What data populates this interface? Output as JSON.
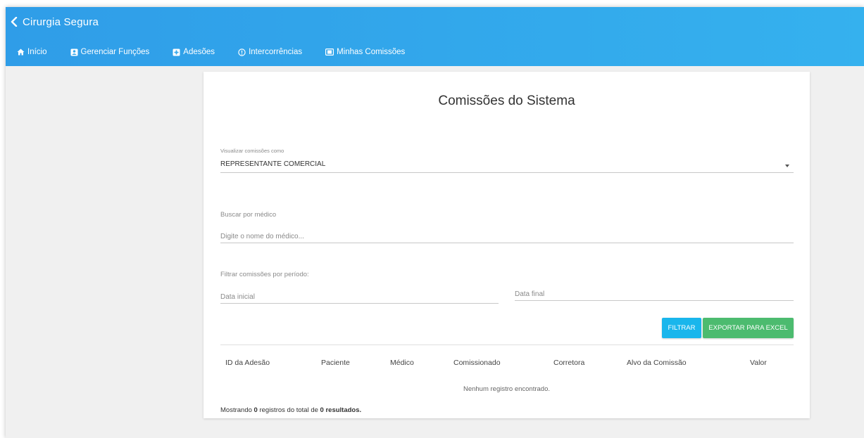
{
  "app": {
    "title": "Cirurgia Segura"
  },
  "nav": {
    "items": [
      {
        "label": "Início",
        "icon": "home-icon"
      },
      {
        "label": "Gerenciar Funções",
        "icon": "user-card-icon"
      },
      {
        "label": "Adesões",
        "icon": "plus-square-icon"
      },
      {
        "label": "Intercorrências",
        "icon": "alert-circle-icon"
      },
      {
        "label": "Minhas Comissões",
        "icon": "money-icon"
      }
    ]
  },
  "page": {
    "title": "Comissões do Sistema"
  },
  "view_as": {
    "label": "Visualizar comissões como",
    "value": "REPRESENTANTE COMERCIAL"
  },
  "doctor_search": {
    "label": "Buscar por médico",
    "placeholder": "Digite o nome do médico..."
  },
  "period": {
    "label": "Filtrar comissões por período:",
    "start_placeholder": "Data inicial",
    "end_placeholder": "Data final"
  },
  "buttons": {
    "filter": "FILTRAR",
    "export": "EXPORTAR PARA EXCEL"
  },
  "table": {
    "columns": [
      "ID da Adesão",
      "Paciente",
      "Médico",
      "Comissionado",
      "Corretora",
      "Alvo da Comissão",
      "Valor"
    ],
    "empty_message": "Nenhum registro encontrado."
  },
  "footer": {
    "prefix": "Mostrando ",
    "shown": "0",
    "middle": " registros do total de ",
    "total": "0 resultados."
  },
  "colors": {
    "header_start": "#2f9de8",
    "header_end": "#35b1ee",
    "filter_button": "#19b6ec",
    "export_button": "#4cbb6f"
  }
}
